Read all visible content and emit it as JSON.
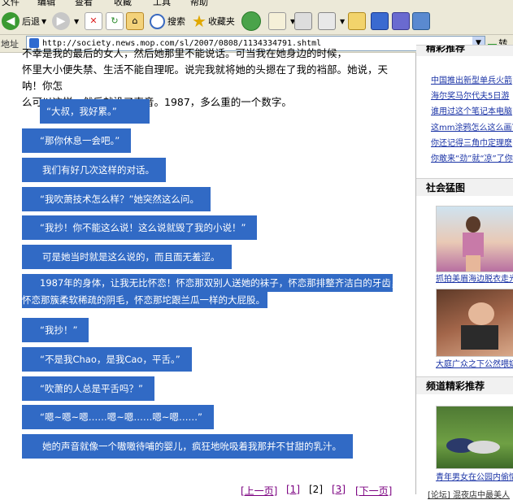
{
  "menu": {
    "items": [
      "文件",
      "编辑",
      "查看",
      "收藏",
      "工具",
      "帮助"
    ]
  },
  "toolbar": {
    "back_label": "后退",
    "search_label": "搜索",
    "favorites_label": "收藏夹"
  },
  "address": {
    "label": "地址",
    "url": "http://society.news.mop.com/sl/2007/0808/1134334791.shtml",
    "go_label": "转到"
  },
  "article": {
    "top_line1": "不幸是我的最后的女人，然后她那里不能说话。可当我在她身边的时候，",
    "top_line2": "怀里大小便失禁、生活不能自理呢。说完我就将她的头摁在了我的裆部。她说，天呐！你怎",
    "top_line3": "么可以这样。然后就没了声音。1987，多么重的一个数字。",
    "lines": [
      "“大叔，我好累。”",
      "“那你休息一会吧。”",
      "我们有好几次这样的对话。",
      "“我吹萧技术怎么样？”她突然这么问。",
      "“我抄！你不能这么说！这么说就毁了我的小说！”",
      "可是她当时就是这么说的，而且面无羞涩。",
      "“我抄！”",
      "“不是我Chao，是我Cao，平舌。”",
      "“吹萧的人总是平舌吗？”",
      "“嗯~嗯~嗯……嗯~嗯……嗯~嗯……”",
      "她的声音就像一个嗷嗷待哺的婴儿，疯狂地吮吸着我那并不甘甜的乳汁。"
    ],
    "wrap_line1": "1987年的身体，让我无比怀恋！怀恋那双别人送她的袜子，怀恋那排整齐洁白的牙齿，",
    "wrap_line2": "怀恋那簇柔软稀疏的阴毛，怀恋那坨跟兰瓜一样的大屁股。"
  },
  "pager": {
    "prev": "[上一页]",
    "p1": "[1]",
    "current": "[2]",
    "p3": "[3]",
    "next": "[下一页]"
  },
  "sidebar": {
    "section1_title": "精彩推荐",
    "links": [
      "中国推出新型单兵火箭",
      "海尔奖马尔代夫5日游",
      "谁用过这个笔记本电脑",
      "这mm涂鸦怎么这么画？",
      "你还记得三角巾定理麽",
      "你敢来“劲”就“凉”了你"
    ],
    "section2_title": "社会猛图",
    "photo1_caption": "抓拍美眉海边脱衣走光",
    "photo2_caption": "大庭广众之下公然喂奶",
    "section3_title": "频道精彩推荐",
    "photo3_caption": "青年男女在公园内偷情",
    "bottom_link": "[论坛] 混夜店中最美人"
  },
  "colors": {
    "selection": "#316ac5",
    "link": "#1a33a6",
    "visited": "#7b0080"
  }
}
